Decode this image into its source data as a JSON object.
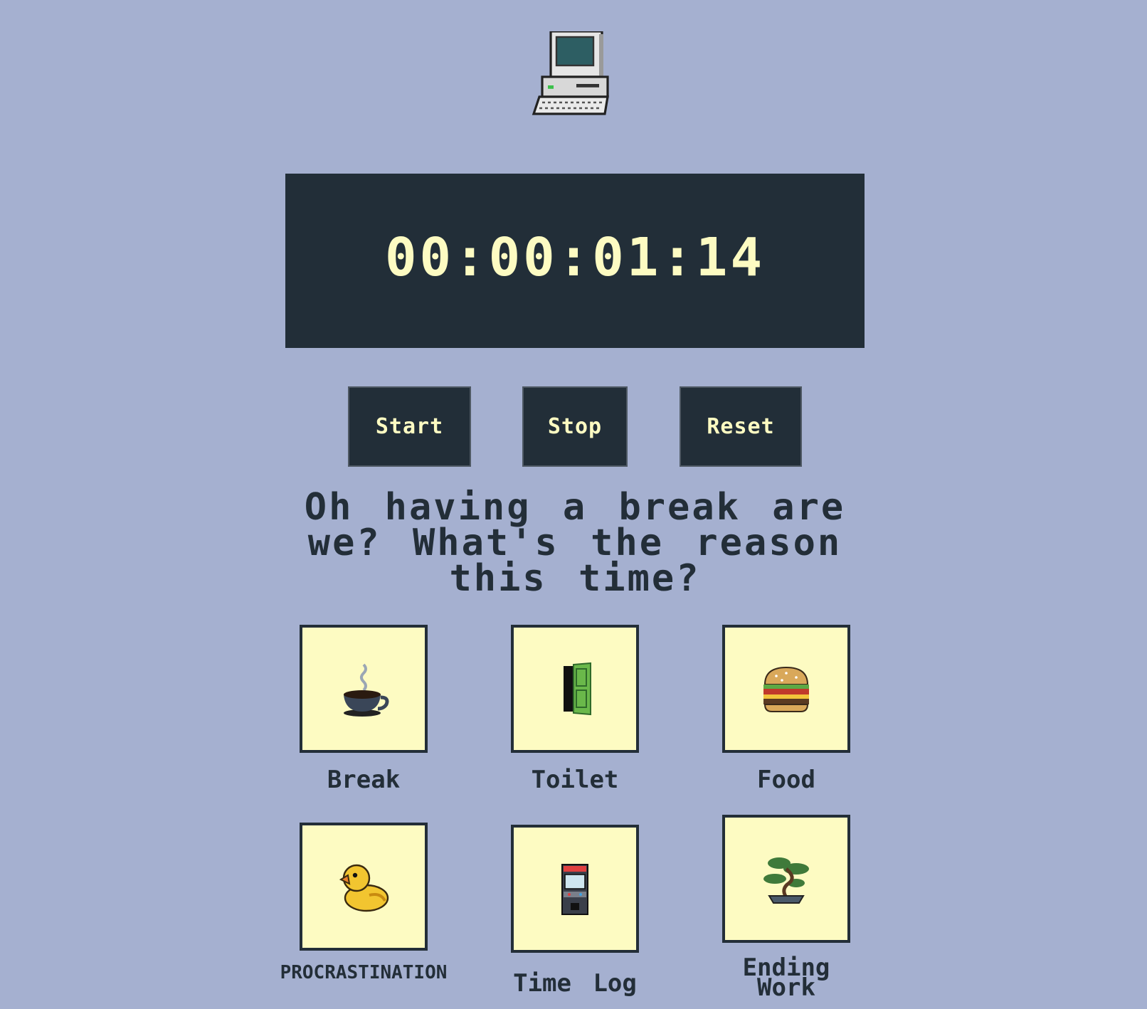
{
  "timer": {
    "display": "00:00:01:14"
  },
  "controls": {
    "start_label": "Start",
    "stop_label": "Stop",
    "reset_label": "Reset"
  },
  "prompt": {
    "text": "Oh having a break are we? What's the reason this time?"
  },
  "reasons": [
    {
      "label": "Break",
      "icon": "coffee-cup-icon"
    },
    {
      "label": "Toilet",
      "icon": "door-icon"
    },
    {
      "label": "Food",
      "icon": "burger-icon"
    },
    {
      "label": "PROCRASTINATION",
      "icon": "rubber-duck-icon"
    },
    {
      "label": "Time Log",
      "icon": "arcade-cabinet-icon"
    },
    {
      "label": "Ending Work",
      "icon": "bonsai-tree-icon"
    }
  ],
  "header": {
    "icon": "computer-icon"
  },
  "colors": {
    "background": "#a5b0d0",
    "panel": "#222e38",
    "accent_text": "#fdfbc2",
    "tile": "#fdfbc2"
  }
}
